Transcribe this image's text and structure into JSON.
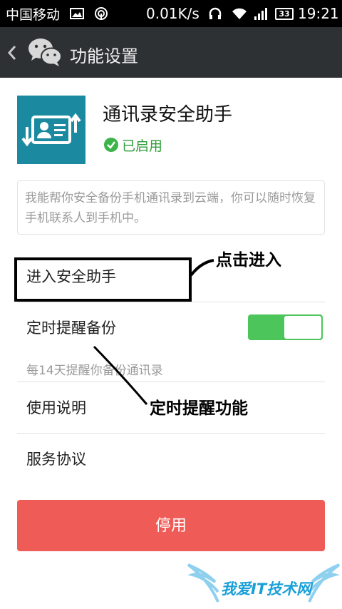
{
  "status_bar": {
    "carrier": "中国移动",
    "speed": "0.01K/s",
    "battery": "33",
    "time": "19:21"
  },
  "nav": {
    "title": "功能设置"
  },
  "app": {
    "name": "通讯录安全助手",
    "status": "已启用",
    "description": "我能帮你安全备份手机通讯录到云端，你可以随时恢复手机联系人到手机中。"
  },
  "menu": {
    "enter_assistant": "进入安全助手",
    "timed_reminder": "定时提醒备份",
    "reminder_note": "每14天提醒你备份通讯录",
    "usage_guide": "使用说明",
    "service_agreement": "服务协议"
  },
  "reminder_toggle": {
    "on": true
  },
  "stop_button": {
    "label": "停用"
  },
  "annotations": {
    "click_enter": "点击进入",
    "timed_reminder_feature": "定时提醒功能"
  },
  "watermark": {
    "text": "我爱IT技术网"
  },
  "colors": {
    "navbar": "#2e3134",
    "app_icon": "#1b8aa1",
    "enabled_green": "#2e9e3a",
    "toggle_on": "#4cc65a",
    "stop_button": "#ef5b56"
  }
}
